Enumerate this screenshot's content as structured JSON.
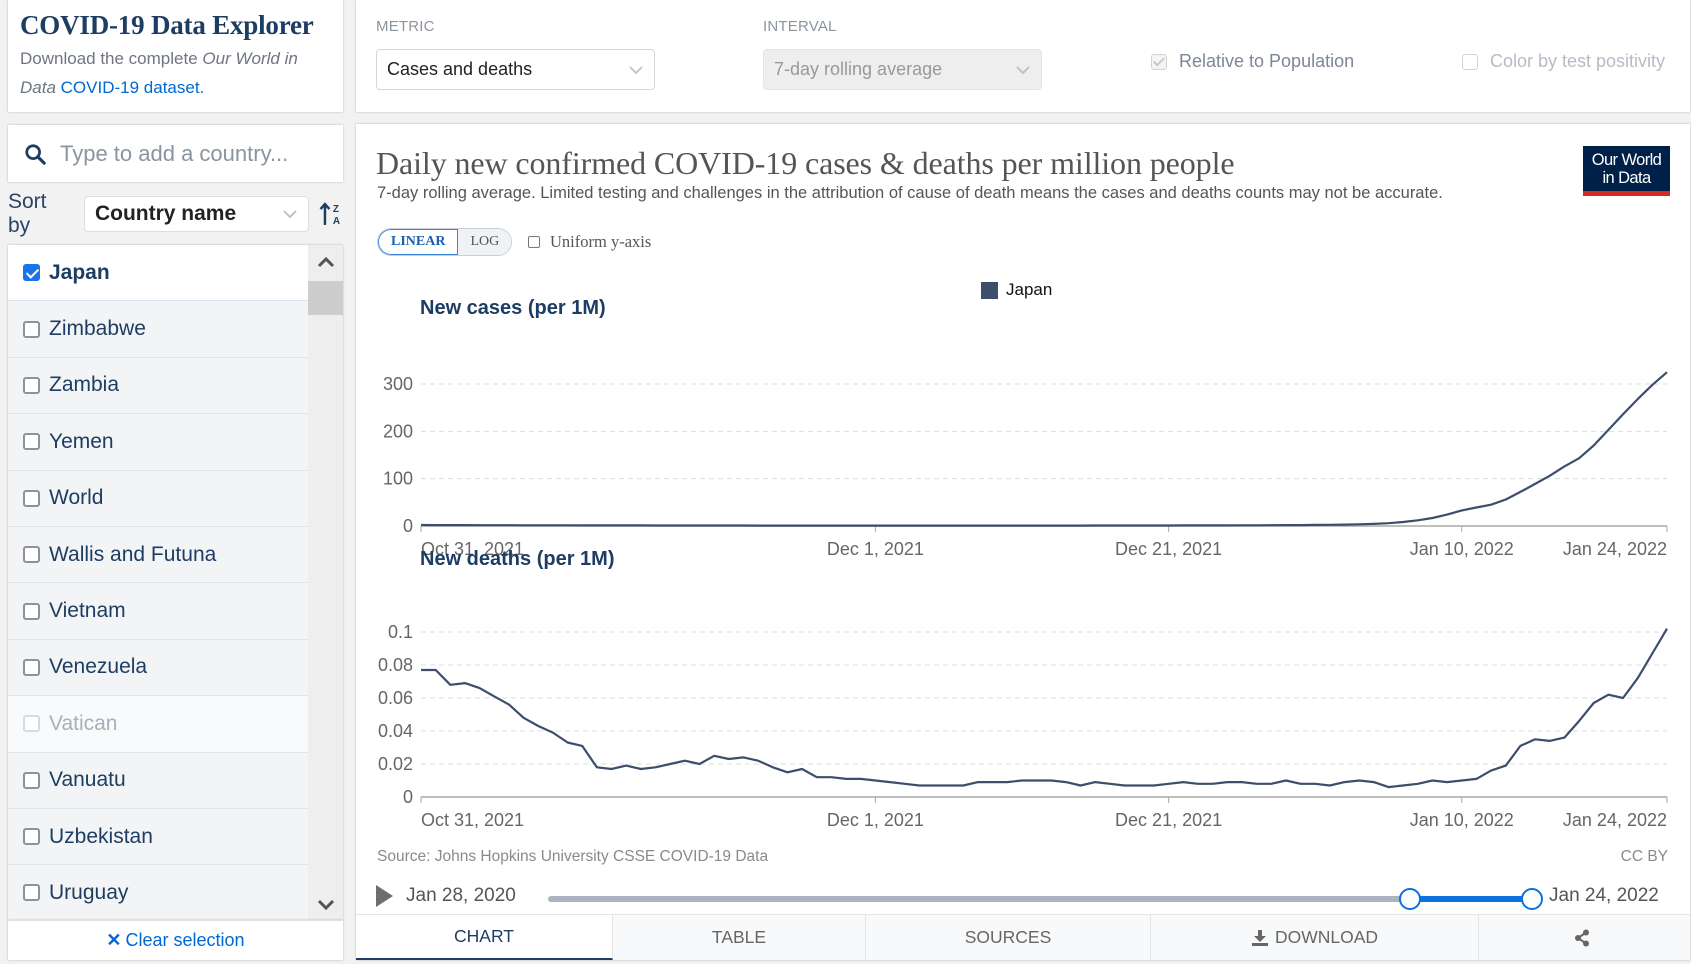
{
  "sidebar": {
    "title": "COVID-19 Data Explorer",
    "description_prefix": "Download the complete ",
    "description_italic_1": "Our World in",
    "description_italic_2": "Data",
    "description_link": "COVID-19 dataset.",
    "search_placeholder": "Type to add a country...",
    "sort_label": "Sort by",
    "sort_value": "Country name",
    "sort_icon": "sort-alpha-icon",
    "countries": [
      {
        "name": "Japan",
        "checked": true,
        "disabled": false
      },
      {
        "name": "Zimbabwe",
        "checked": false,
        "disabled": false
      },
      {
        "name": "Zambia",
        "checked": false,
        "disabled": false
      },
      {
        "name": "Yemen",
        "checked": false,
        "disabled": false
      },
      {
        "name": "World",
        "checked": false,
        "disabled": false
      },
      {
        "name": "Wallis and Futuna",
        "checked": false,
        "disabled": false
      },
      {
        "name": "Vietnam",
        "checked": false,
        "disabled": false
      },
      {
        "name": "Venezuela",
        "checked": false,
        "disabled": false
      },
      {
        "name": "Vatican",
        "checked": false,
        "disabled": true
      },
      {
        "name": "Vanuatu",
        "checked": false,
        "disabled": false
      },
      {
        "name": "Uzbekistan",
        "checked": false,
        "disabled": false
      },
      {
        "name": "Uruguay",
        "checked": false,
        "disabled": false
      }
    ],
    "clear_label": "Clear selection"
  },
  "controls": {
    "metric_label": "METRIC",
    "metric_value": "Cases and deaths",
    "interval_label": "INTERVAL",
    "interval_value": "7-day rolling average",
    "relative_label": "Relative to Population",
    "relative_checked": true,
    "positivity_label": "Color by test positivity",
    "positivity_checked": false
  },
  "chart": {
    "title": "Daily new confirmed COVID-19 cases & deaths per million people",
    "subtitle": "7-day rolling average. Limited testing and challenges in the attribution of cause of death means the cases and deaths counts may not be accurate.",
    "logo_line1": "Our World",
    "logo_line2": "in Data",
    "scale_linear": "LINEAR",
    "scale_log": "LOG",
    "uniform_label": "Uniform y-axis",
    "source": "Source: Johns Hopkins University CSSE COVID-19 Data",
    "license": "CC BY",
    "timeline_start": "Jan 28, 2020",
    "timeline_end": "Jan 24, 2022",
    "timeline_selection": {
      "start_fraction": 0.876,
      "end_fraction": 1.0
    },
    "tabs": [
      "CHART",
      "TABLE",
      "SOURCES",
      "DOWNLOAD"
    ],
    "active_tab": "CHART",
    "line_color": "#3c4e6b"
  },
  "chart_data": [
    {
      "type": "line",
      "title": "New cases (per 1M)",
      "legend": [
        "Japan"
      ],
      "legend_placement": "top-center",
      "x_start": "2021-10-31",
      "x_end": "2022-01-24",
      "x_ticks": [
        {
          "label": "Oct 31, 2021",
          "day": 0
        },
        {
          "label": "Dec 1, 2021",
          "day": 31
        },
        {
          "label": "Dec 21, 2021",
          "day": 51
        },
        {
          "label": "Jan 10, 2022",
          "day": 71
        },
        {
          "label": "Jan 24, 2022",
          "day": 85
        }
      ],
      "y_ticks": [
        0,
        100,
        200,
        300
      ],
      "ylim": [
        0,
        300
      ],
      "grid": true,
      "series": [
        {
          "name": "Japan",
          "values": [
            2.1,
            2.0,
            1.9,
            1.8,
            1.7,
            1.6,
            1.6,
            1.5,
            1.5,
            1.4,
            1.4,
            1.3,
            1.3,
            1.2,
            1.2,
            1.2,
            1.1,
            1.1,
            1.1,
            1.0,
            1.0,
            1.0,
            1.0,
            0.9,
            0.9,
            0.9,
            0.9,
            0.9,
            0.9,
            0.8,
            0.8,
            0.8,
            0.8,
            0.8,
            0.8,
            0.8,
            0.8,
            0.8,
            0.8,
            0.8,
            0.9,
            0.9,
            0.9,
            0.9,
            0.9,
            0.9,
            1.0,
            1.0,
            1.0,
            1.0,
            1.1,
            1.1,
            1.2,
            1.2,
            1.3,
            1.3,
            1.4,
            1.5,
            1.6,
            1.8,
            2.0,
            2.3,
            2.6,
            3.0,
            3.6,
            4.5,
            6.0,
            8.5,
            12,
            17,
            24,
            33,
            39,
            45,
            56,
            72,
            89,
            106,
            126,
            143,
            170,
            203,
            236,
            268,
            298,
            325
          ]
        }
      ]
    },
    {
      "type": "line",
      "title": "New deaths (per 1M)",
      "legend": [
        "Japan"
      ],
      "x_start": "2021-10-31",
      "x_end": "2022-01-24",
      "x_ticks": [
        {
          "label": "Oct 31, 2021",
          "day": 0
        },
        {
          "label": "Dec 1, 2021",
          "day": 31
        },
        {
          "label": "Dec 21, 2021",
          "day": 51
        },
        {
          "label": "Jan 10, 2022",
          "day": 71
        },
        {
          "label": "Jan 24, 2022",
          "day": 85
        }
      ],
      "y_ticks": [
        0,
        0.02,
        0.04,
        0.06,
        0.08,
        0.1
      ],
      "y_tick_labels": [
        "0",
        "0.02",
        "0.04",
        "0.06",
        "0.08",
        "0.1"
      ],
      "ylim": [
        0,
        0.1
      ],
      "grid": true,
      "series": [
        {
          "name": "Japan",
          "values": [
            0.077,
            0.077,
            0.068,
            0.069,
            0.066,
            0.061,
            0.056,
            0.048,
            0.043,
            0.039,
            0.033,
            0.031,
            0.018,
            0.017,
            0.019,
            0.017,
            0.018,
            0.02,
            0.022,
            0.02,
            0.025,
            0.023,
            0.024,
            0.022,
            0.018,
            0.015,
            0.017,
            0.012,
            0.012,
            0.011,
            0.011,
            0.01,
            0.009,
            0.008,
            0.007,
            0.007,
            0.007,
            0.007,
            0.009,
            0.009,
            0.009,
            0.01,
            0.01,
            0.01,
            0.009,
            0.007,
            0.009,
            0.008,
            0.007,
            0.007,
            0.007,
            0.008,
            0.009,
            0.008,
            0.008,
            0.009,
            0.009,
            0.008,
            0.008,
            0.01,
            0.008,
            0.008,
            0.007,
            0.009,
            0.01,
            0.009,
            0.006,
            0.007,
            0.008,
            0.01,
            0.009,
            0.01,
            0.011,
            0.016,
            0.019,
            0.031,
            0.035,
            0.034,
            0.036,
            0.046,
            0.057,
            0.062,
            0.06,
            0.072,
            0.087,
            0.102
          ]
        }
      ]
    }
  ]
}
